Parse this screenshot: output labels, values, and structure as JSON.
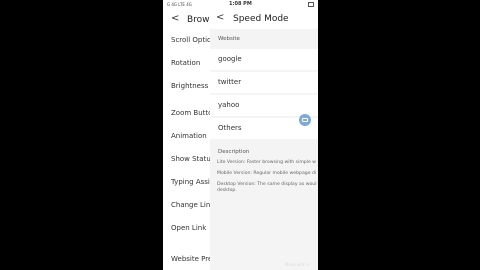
{
  "statusbar": {
    "left": "G  4G LTE  4G",
    "time": "1:08 PM"
  },
  "background_screen": {
    "back": "<",
    "title": "Browser",
    "items": [
      "Scroll Option",
      "Rotation",
      "Brightness",
      "Zoom Button",
      "Animation",
      "Show Status",
      "Typing Assis",
      "Change Link",
      "Open Link",
      "Website Pref"
    ]
  },
  "panel": {
    "back": "<",
    "title": "Speed Mode",
    "website_label": "Website",
    "options": [
      "google",
      "twitter",
      "yahoo",
      "Others"
    ],
    "description_label": "Description",
    "desc_lite": "Lite Version: Faster browsing with simple w",
    "desc_mobile": "Mobile Version: Regular mobile webpage di",
    "desc_desktop_1": "Desktop Version: The same display as woul",
    "desc_desktop_2": "desktop."
  },
  "watermark": "Made with a"
}
